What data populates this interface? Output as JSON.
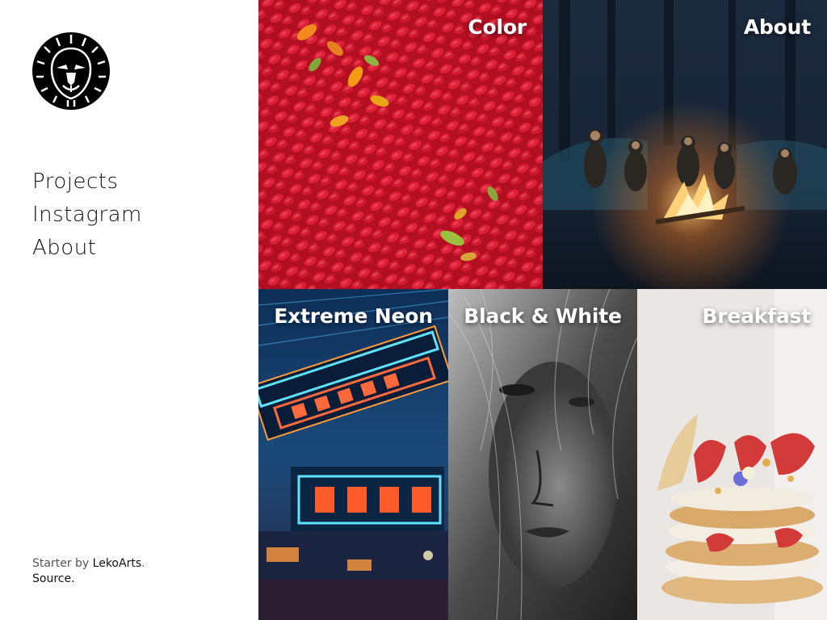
{
  "nav": {
    "items": [
      {
        "label": "Projects"
      },
      {
        "label": "Instagram"
      },
      {
        "label": "About"
      }
    ]
  },
  "footer": {
    "prefix": "Starter by ",
    "author": "LekoArts",
    "after_author": ".",
    "source": "Source."
  },
  "tiles": [
    {
      "title": "Color",
      "image": "red-chili-peppers"
    },
    {
      "title": "About",
      "image": "campfire-group-in-forest"
    },
    {
      "title": "Extreme Neon",
      "image": "neon-signs-street"
    },
    {
      "title": "Black & White",
      "image": "black-and-white-portrait"
    },
    {
      "title": "Breakfast",
      "image": "pancakes-with-strawberries"
    }
  ],
  "logo": {
    "icon": "lion-head-icon"
  }
}
